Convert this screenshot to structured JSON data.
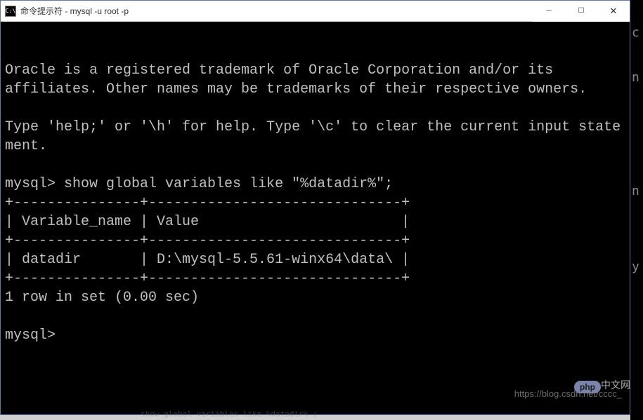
{
  "window": {
    "icon_text": "C:\\",
    "title": "命令提示符 - mysql  -u root -p"
  },
  "terminal": {
    "lines": [
      "Oracle is a registered trademark of Oracle Corporation and/or its",
      "affiliates. Other names may be trademarks of their respective owners.",
      "",
      "Type 'help;' or '\\h' for help. Type '\\c' to clear the current input statement.",
      "",
      "mysql> show global variables like \"%datadir%\";",
      "+---------------+------------------------------+",
      "| Variable_name | Value                        |",
      "+---------------+------------------------------+",
      "| datadir       | D:\\mysql-5.5.61-winx64\\data\\ |",
      "+---------------+------------------------------+",
      "1 row in set (0.00 sec)",
      "",
      "mysql>"
    ]
  },
  "right_edge_chars": {
    "c1": "c",
    "c2": "n",
    "c3": "n",
    "c4": "y"
  },
  "watermark": {
    "url": "https://blog.csdn.net/cccc_",
    "php": "php",
    "cn": "中文网"
  },
  "ghost_text": "show global variables like  %datadir% ;"
}
